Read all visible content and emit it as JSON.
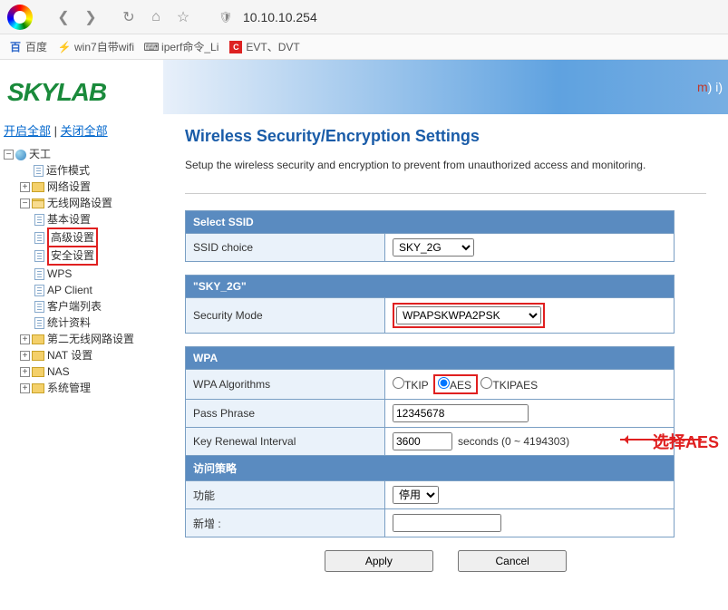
{
  "browser": {
    "url": "10.10.10.254",
    "bookmarks": [
      "百度",
      "win7自带wifi",
      "iperf命令_Li",
      "EVT、DVT"
    ]
  },
  "logo": "SKYLAB",
  "banner_right": "m) i)",
  "tree_top": {
    "open_all": "开启全部",
    "close_all": "关闭全部"
  },
  "tree": {
    "root": "天工",
    "op_mode": "运作模式",
    "net": "网络设置",
    "wlan": "无线网路设置",
    "wlan_items": {
      "basic": "基本设置",
      "adv": "高级设置",
      "sec": "安全设置",
      "wps": "WPS",
      "ap": "AP Client",
      "clients": "客户端列表",
      "stats": "统计资料"
    },
    "wlan2": "第二无线网路设置",
    "nat": "NAT 设置",
    "nas": "NAS",
    "sys": "系统管理"
  },
  "page": {
    "title": "Wireless Security/Encryption Settings",
    "desc": "Setup the wireless security and encryption to prevent from unauthorized access and monitoring."
  },
  "ssid_section": {
    "header": "Select SSID",
    "label": "SSID choice",
    "value": "SKY_2G"
  },
  "sec_section": {
    "header": "\"SKY_2G\"",
    "label": "Security Mode",
    "value": "WPAPSKWPA2PSK"
  },
  "wpa_section": {
    "header": "WPA",
    "algo_label": "WPA Algorithms",
    "algo_opts": {
      "tkip": "TKIP",
      "aes": "AES",
      "both": "TKIPAES"
    },
    "pass_label": "Pass Phrase",
    "pass_value": "12345678",
    "renew_label": "Key Renewal Interval",
    "renew_value": "3600",
    "renew_suffix": "seconds   (0 ~ 4194303)"
  },
  "policy_section": {
    "header": "访问策略",
    "func_label": "功能",
    "func_value": "停用",
    "add_label": "新增 :"
  },
  "buttons": {
    "apply": "Apply",
    "cancel": "Cancel"
  },
  "annotation": "选择AES"
}
